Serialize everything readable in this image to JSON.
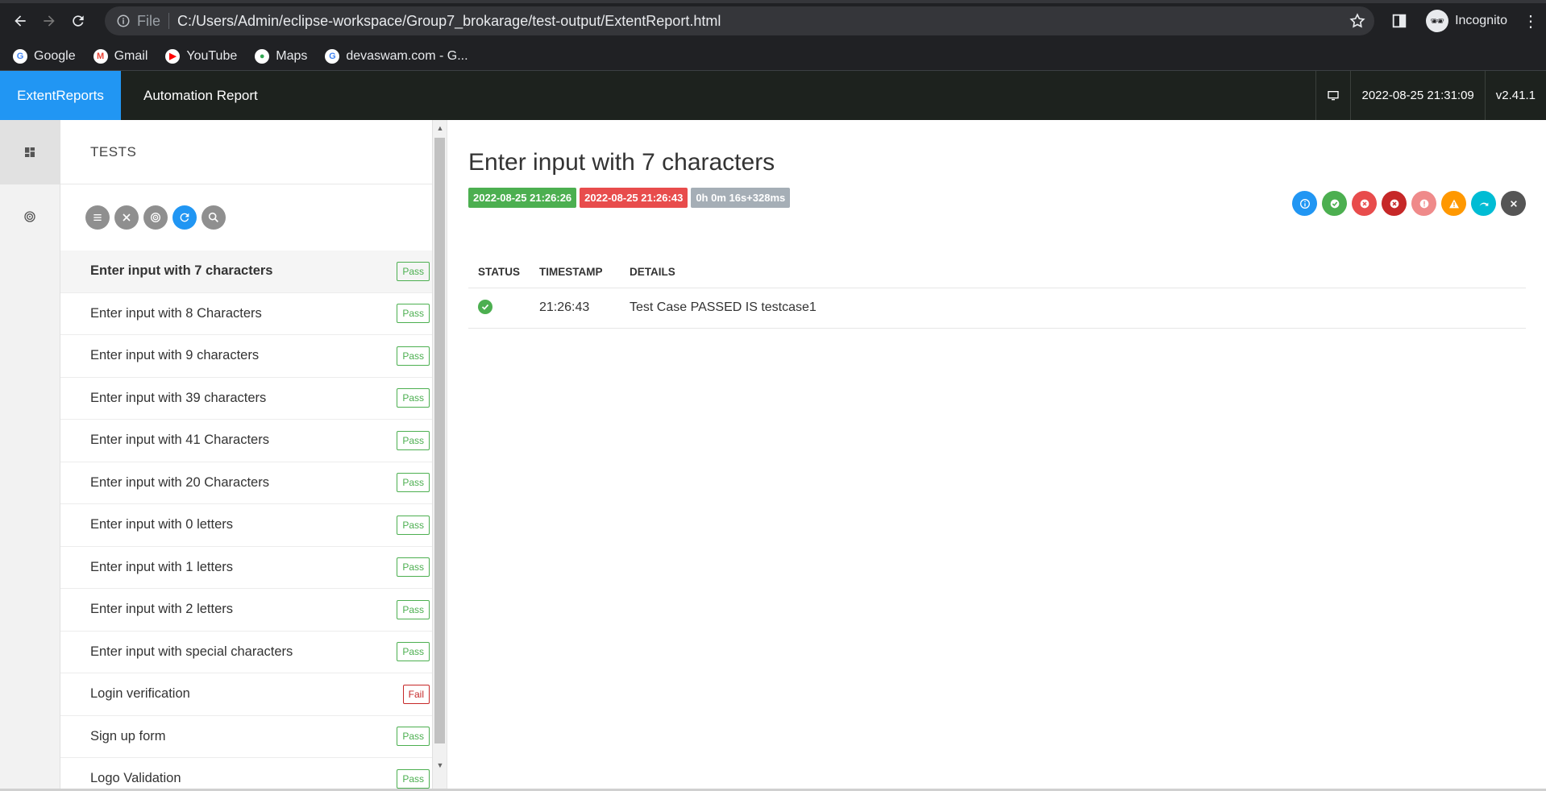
{
  "browser": {
    "scheme": "File",
    "url": "C:/Users/Admin/eclipse-workspace/Group7_brokarage/test-output/ExtentReport.html",
    "profile_label": "Incognito",
    "bookmarks": [
      {
        "label": "Google",
        "icon": "google-icon",
        "color": "#4285f4"
      },
      {
        "label": "Gmail",
        "icon": "gmail-icon",
        "color": "#ea4335"
      },
      {
        "label": "YouTube",
        "icon": "youtube-icon",
        "color": "#ff0000"
      },
      {
        "label": "Maps",
        "icon": "maps-icon",
        "color": "#34a853"
      },
      {
        "label": "devaswam.com - G...",
        "icon": "google-icon",
        "color": "#4285f4"
      }
    ]
  },
  "header": {
    "brand": "ExtentReports",
    "report_name": "Automation Report",
    "datetime": "2022-08-25 21:31:09",
    "version": "v2.41.1"
  },
  "tests_panel": {
    "title": "TESTS",
    "tests": [
      {
        "name": "Enter input with 7 characters",
        "status": "Pass"
      },
      {
        "name": "Enter input with 8 Characters",
        "status": "Pass"
      },
      {
        "name": "Enter input with 9 characters",
        "status": "Pass"
      },
      {
        "name": "Enter input with 39 characters",
        "status": "Pass"
      },
      {
        "name": "Enter input with 41 Characters",
        "status": "Pass"
      },
      {
        "name": "Enter input with 20 Characters",
        "status": "Pass"
      },
      {
        "name": "Enter input with 0 letters",
        "status": "Pass"
      },
      {
        "name": "Enter input with 1 letters",
        "status": "Pass"
      },
      {
        "name": "Enter input with 2 letters",
        "status": "Pass"
      },
      {
        "name": "Enter input with special characters",
        "status": "Pass"
      },
      {
        "name": "Login verification",
        "status": "Fail"
      },
      {
        "name": "Sign up form",
        "status": "Pass"
      },
      {
        "name": "Logo Validation",
        "status": "Pass"
      }
    ]
  },
  "detail": {
    "title": "Enter input with 7 characters",
    "start_time": "2022-08-25 21:26:26",
    "end_time": "2022-08-25 21:26:43",
    "duration": "0h 0m 16s+328ms",
    "columns": {
      "status": "STATUS",
      "timestamp": "TIMESTAMP",
      "details": "DETAILS"
    },
    "logs": [
      {
        "status": "pass",
        "timestamp": "21:26:43",
        "details": "Test Case PASSED IS testcase1"
      }
    ]
  },
  "colors": {
    "accent": "#2196f3",
    "pass": "#4caf50",
    "fail": "#e84c4c",
    "header_bg": "#1d221e"
  }
}
